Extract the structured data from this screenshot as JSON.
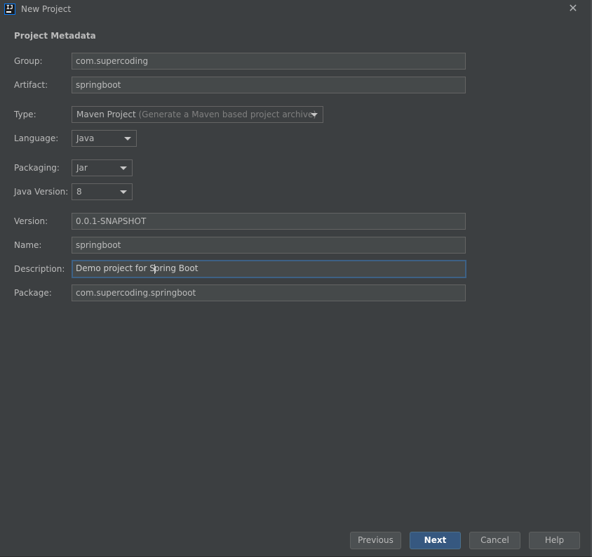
{
  "window": {
    "title": "New Project",
    "app_icon_text": "IJ"
  },
  "section_title": "Project Metadata",
  "form": {
    "group": {
      "label": "Group:",
      "value": "com.supercoding"
    },
    "artifact": {
      "label": "Artifact:",
      "value": "springboot"
    },
    "type": {
      "label": "Type:",
      "value": "Maven Project",
      "hint": "(Generate a Maven based project archive)"
    },
    "language": {
      "label": "Language:",
      "value": "Java"
    },
    "packaging": {
      "label": "Packaging:",
      "value": "Jar"
    },
    "java_version": {
      "label": "Java Version:",
      "value": "8"
    },
    "version": {
      "label": "Version:",
      "value": "0.0.1-SNAPSHOT"
    },
    "name": {
      "label": "Name:",
      "value": "springboot"
    },
    "description": {
      "label": "Description:",
      "value_before_caret": "Demo project for S",
      "value_after_caret": "pring Boot"
    },
    "package": {
      "label": "Package:",
      "value": "com.supercoding.springboot"
    }
  },
  "buttons": {
    "previous": "Previous",
    "next": "Next",
    "cancel": "Cancel",
    "help": "Help"
  },
  "colors": {
    "background": "#3c3f41",
    "field_background": "#45494a",
    "focus_border": "#3d6185",
    "primary_button": "#365880"
  }
}
